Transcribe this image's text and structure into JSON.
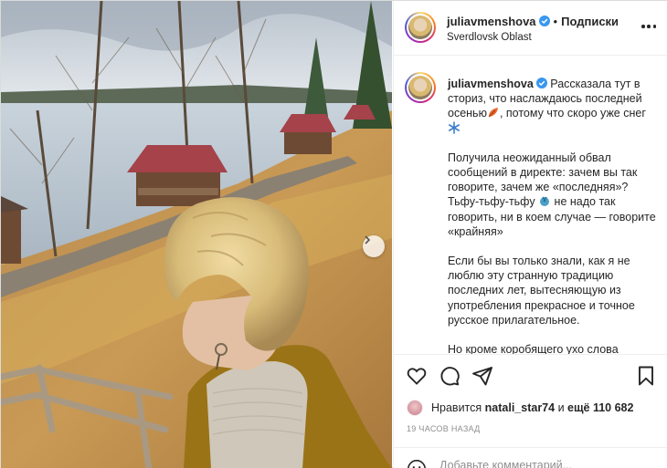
{
  "post": {
    "username": "juliavmenshova",
    "follow_label": "Подписки",
    "location": "Sverdlovsk Oblast",
    "caption": {
      "p1_a": "Рассказала тут в сториз, что наслаждаюсь последней осенью",
      "p1_b": ", потому что скоро уже снег",
      "p2_a": "Получила неожиданный обвал сообщений в директе: зачем вы так говорите, зачем же «последняя»? Тьфу-тьфу-тьфу",
      "p2_b": " не надо так говорить, ни в коем случае — говорите «крайняя»",
      "p3": "Если бы вы только знали, как я не люблю эту странную традицию последних лет, вытесняющую из употребления прекрасное и точное русское прилагательное.",
      "p4": "Но кроме коробящего ухо слова «крайний», меня занимает и сам факт"
    },
    "likes": {
      "prefix": "Нравится",
      "liker": "natali_star74",
      "middle": "и",
      "count": "ещё 110 682"
    },
    "time": "19 ЧАСОВ НАЗАД",
    "comment_placeholder": "Добавьте комментарий..."
  },
  "icons": {
    "verified": "verified-badge-icon",
    "more": "more-options-icon",
    "carousel_next": "chevron-right-icon",
    "like": "heart-icon",
    "comment": "comment-icon",
    "share": "paper-plane-icon",
    "save": "bookmark-icon",
    "emoji": "smiley-icon"
  },
  "colors": {
    "verified": "#3897f0",
    "text": "#262626",
    "muted": "#8e8e8e",
    "border": "#dbdbdb"
  }
}
